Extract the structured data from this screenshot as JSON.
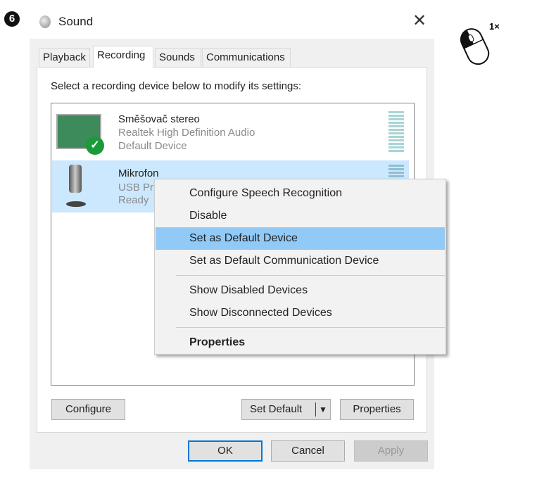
{
  "step_number": "6",
  "click_hint": "1×",
  "window": {
    "title": "Sound",
    "close_label": "✕"
  },
  "tabs": [
    "Playback",
    "Recording",
    "Sounds",
    "Communications"
  ],
  "instruction": "Select a recording device below to modify its settings:",
  "devices": [
    {
      "name": "Směšovač stereo",
      "driver": "Realtek High Definition Audio",
      "status": "Default Device"
    },
    {
      "name": "Mikrofon",
      "driver": "USB Pr",
      "status": "Ready"
    }
  ],
  "context_menu": {
    "items": [
      "Configure Speech Recognition",
      "Disable",
      "Set as Default Device",
      "Set as Default Communication Device",
      "Show Disabled Devices",
      "Show Disconnected Devices",
      "Properties"
    ],
    "highlighted": "Set as Default Device"
  },
  "buttons": {
    "configure": "Configure",
    "set_default": "Set Default",
    "properties": "Properties",
    "ok": "OK",
    "cancel": "Cancel",
    "apply": "Apply"
  },
  "colors": {
    "selection": "#cce8ff",
    "menu_highlight": "#91c9f7",
    "focus": "#0078d7"
  }
}
